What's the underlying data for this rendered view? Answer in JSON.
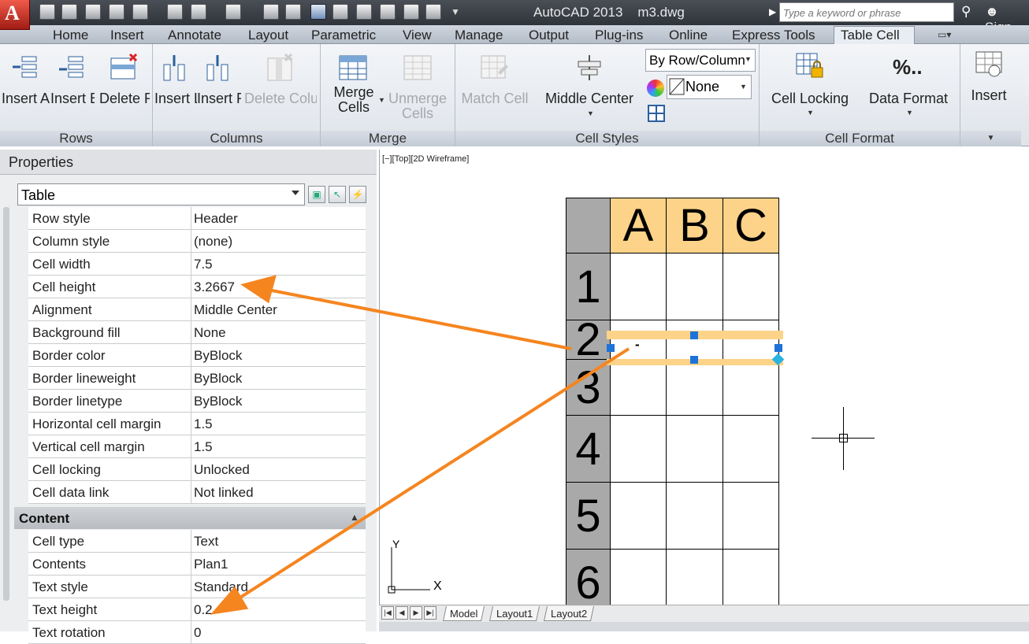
{
  "title_bar": {
    "app_title": "AutoCAD 2013",
    "doc_title": "m3.dwg",
    "search_placeholder": "Type a keyword or phrase",
    "sign_in": "Sign"
  },
  "ribbon_tabs": [
    "Home",
    "Insert",
    "Annotate",
    "Layout",
    "Parametric",
    "View",
    "Manage",
    "Output",
    "Plug-ins",
    "Online",
    "Express Tools",
    "Table Cell"
  ],
  "active_tab": "Table Cell",
  "ribbon": {
    "rows": {
      "panel": "Rows",
      "insert_above": "Insert Above",
      "insert_below": "Insert Below",
      "delete_rows": "Delete Row(s)"
    },
    "columns": {
      "panel": "Columns",
      "insert_left": "Insert Left",
      "insert_right": "Insert Right",
      "delete_columns": "Delete Column(s)"
    },
    "merge": {
      "panel": "Merge",
      "merge_cells": "Merge Cells",
      "unmerge_cells": "Unmerge Cells"
    },
    "cell_styles": {
      "panel": "Cell Styles",
      "match_cell": "Match Cell",
      "middle_center": "Middle Center",
      "by_row_column": "By Row/Column",
      "fill_none": "None"
    },
    "cell_format": {
      "panel": "Cell Format",
      "cell_locking": "Cell Locking",
      "data_format": "Data Format"
    },
    "insert": {
      "label": "Insert"
    }
  },
  "properties": {
    "title": "Properties",
    "selection": "Table",
    "cell_rows": [
      {
        "name": "Row style",
        "value": "Header"
      },
      {
        "name": "Column style",
        "value": "(none)"
      },
      {
        "name": "Cell width",
        "value": "7.5"
      },
      {
        "name": "Cell height",
        "value": "3.2667"
      },
      {
        "name": "Alignment",
        "value": "Middle Center"
      },
      {
        "name": "Background fill",
        "value": "None"
      },
      {
        "name": "Border color",
        "value": "ByBlock"
      },
      {
        "name": "Border lineweight",
        "value": "ByBlock"
      },
      {
        "name": "Border linetype",
        "value": "ByBlock"
      },
      {
        "name": "Horizontal cell margin",
        "value": "1.5"
      },
      {
        "name": "Vertical cell margin",
        "value": "1.5"
      },
      {
        "name": "Cell locking",
        "value": "Unlocked"
      },
      {
        "name": "Cell data link",
        "value": "Not linked"
      }
    ],
    "content_header": "Content",
    "content_rows": [
      {
        "name": "Cell type",
        "value": "Text"
      },
      {
        "name": "Contents",
        "value": "Plan1"
      },
      {
        "name": "Text style",
        "value": "Standard"
      },
      {
        "name": "Text height",
        "value": "0.2"
      },
      {
        "name": "Text rotation",
        "value": "0"
      }
    ]
  },
  "viewport": {
    "label": "[−][Top][2D Wireframe]",
    "ucs_x": "X",
    "ucs_y": "Y",
    "table": {
      "columns": [
        "A",
        "B",
        "C"
      ],
      "rows": [
        "1",
        "2",
        "3",
        "4",
        "5",
        "6"
      ],
      "selected_cell_text": "-"
    }
  },
  "layout_tabs": [
    "Model",
    "Layout1",
    "Layout2"
  ],
  "colors": {
    "header_fill": "#fdd389",
    "row_label_fill": "#a9a9a9",
    "arrow": "#f5851f",
    "grip": "#1e73d8"
  }
}
